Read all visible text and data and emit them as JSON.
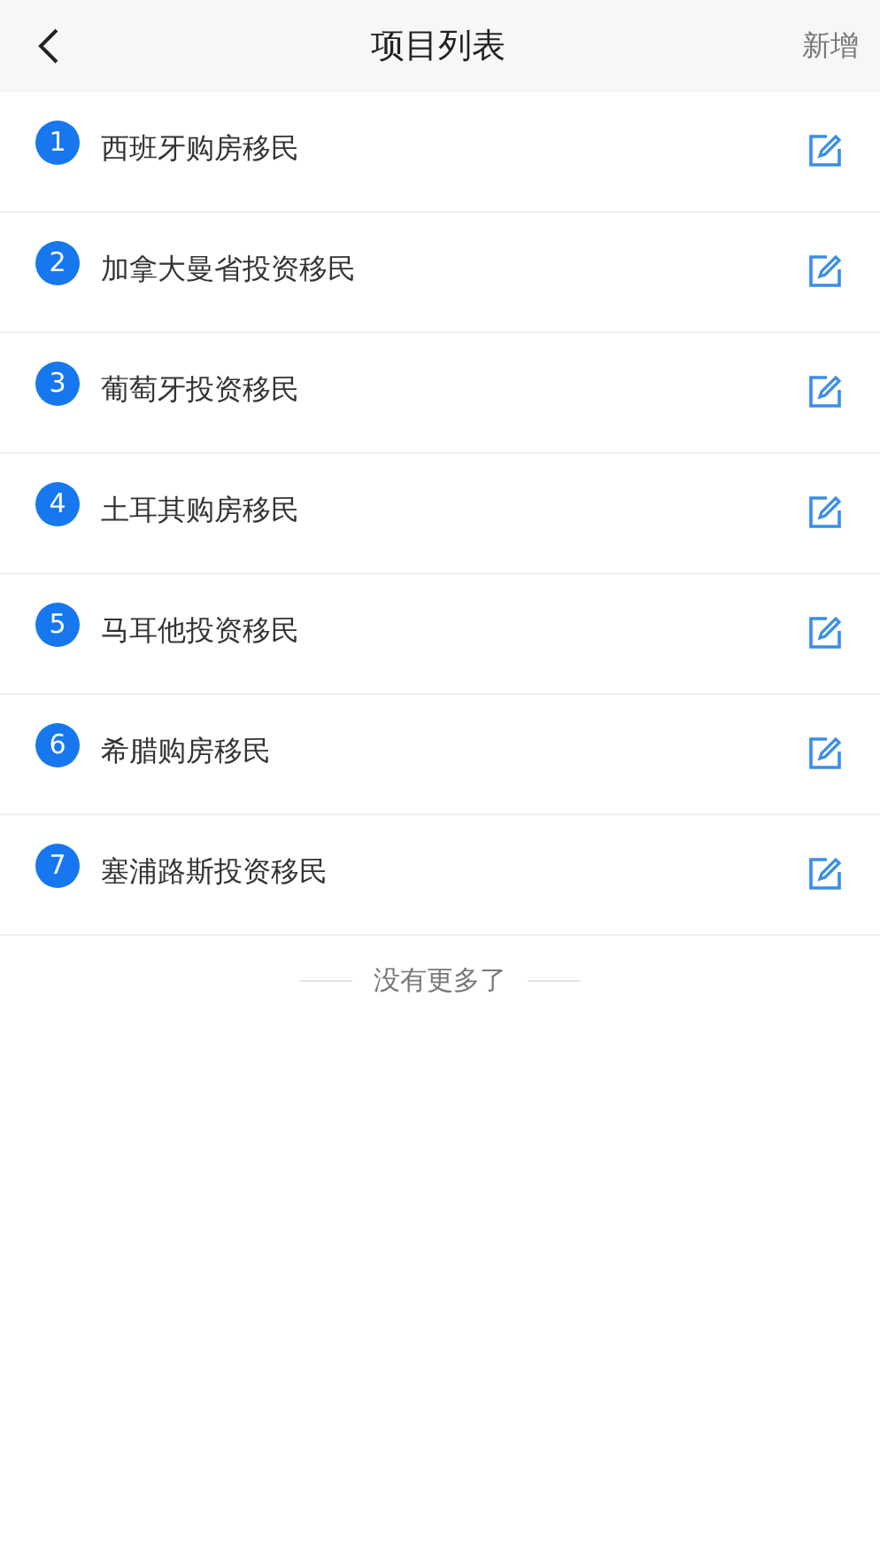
{
  "header": {
    "title": "项目列表",
    "action": "新增"
  },
  "items": [
    {
      "number": "1",
      "name": "西班牙购房移民"
    },
    {
      "number": "2",
      "name": "加拿大曼省投资移民"
    },
    {
      "number": "3",
      "name": "葡萄牙投资移民"
    },
    {
      "number": "4",
      "name": "土耳其购房移民"
    },
    {
      "number": "5",
      "name": "马耳他投资移民"
    },
    {
      "number": "6",
      "name": "希腊购房移民"
    },
    {
      "number": "7",
      "name": "塞浦路斯投资移民"
    }
  ],
  "footer": "没有更多了"
}
